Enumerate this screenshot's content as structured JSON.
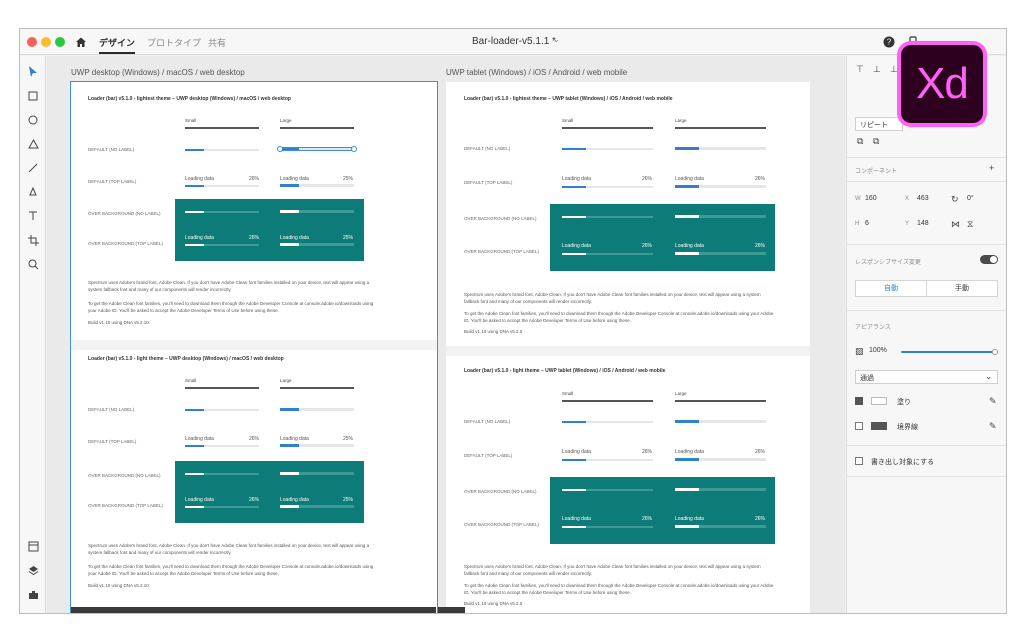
{
  "app": {
    "tabs": [
      "デザイン",
      "プロトタイプ",
      "共有"
    ],
    "active_tab": "デザイン",
    "doc_title": "Bar-loader-v5.1.1 *",
    "logo_text": "Xd",
    "colors": {
      "accent": "#2f80d1",
      "teal": "#0d7c78",
      "logo_pink": "#ff61f6",
      "logo_bg": "#2e001f"
    }
  },
  "toolbar_icons": [
    "select-icon",
    "rectangle-icon",
    "ellipse-icon",
    "polygon-icon",
    "line-icon",
    "pen-icon",
    "text-icon",
    "artboard-icon",
    "zoom-icon"
  ],
  "toolbar_bottom_icons": [
    "assets-icon",
    "layers-icon",
    "plugins-icon"
  ],
  "artboards": {
    "desktop_title": "UWP desktop (Windows) / macOS / web desktop",
    "mobile_title": "UWP tablet (Windows) / iOS / Android / web mobile"
  },
  "desktop": {
    "sec1_heading": "Loader (bar) v5.1.0 - lightest theme – UWP desktop (Windows) / macOS / web desktop",
    "sec2_heading": "Loader (bar) v5.1.0 - light theme – UWP desktop (Windows) / macOS / web desktop",
    "col_small": "Small",
    "col_large": "Large",
    "row1": "DEFAULT (NO LABEL)",
    "row2": "DEFAULT (TOP LABEL)",
    "row3": "OVER BACKGROUND (NO LABEL)",
    "row4": "OVER BACKGROUND (TOP LABEL)",
    "loading": "Loading data",
    "pct": "26%",
    "pct_large": "25%",
    "para1": "Spectrum uses Adobe's brand font, Adobe Clean. If you don't have Adobe Clean font families installed on your device, text will appear using a system fallback font and many of our components will render incorrectly.",
    "para2": "To get the Adobe Clean font families, you'll need to download them through the Adobe Developer Console at console.adobe.io/downloads using your Adobe ID. You'll be asked to accept the Adobe Developer Terms of Use before using these.",
    "build": "Build v1.10 using DNA v5.2.10"
  },
  "mobile": {
    "sec1_heading": "Loader (bar) v5.1.0 - lightest theme – UWP tablet (Windows) / iOS / Android / web mobile",
    "sec2_heading": "Loader (bar) v5.1.0 - light theme – UWP tablet (Windows) / iOS / Android / web mobile",
    "pct_large": "26%",
    "build": "Build v1.10 using DNA v5.2.0"
  },
  "panel": {
    "repeat_grid": "リピート",
    "components_label": "コンポーネント",
    "w_label": "W",
    "w_value": "160",
    "h_label": "H",
    "h_value": "6",
    "x_label": "X",
    "x_value": "463",
    "y_label": "Y",
    "y_value": "148",
    "rotation": "0°",
    "responsive_label": "レスポンシブサイズ変更",
    "seg_auto": "自動",
    "seg_manual": "手動",
    "appearance_label": "アピアランス",
    "opacity": "100%",
    "blend_mode": "通過",
    "fill_label": "塗り",
    "border_label": "境界線",
    "export_label": "書き出し対象にする"
  }
}
